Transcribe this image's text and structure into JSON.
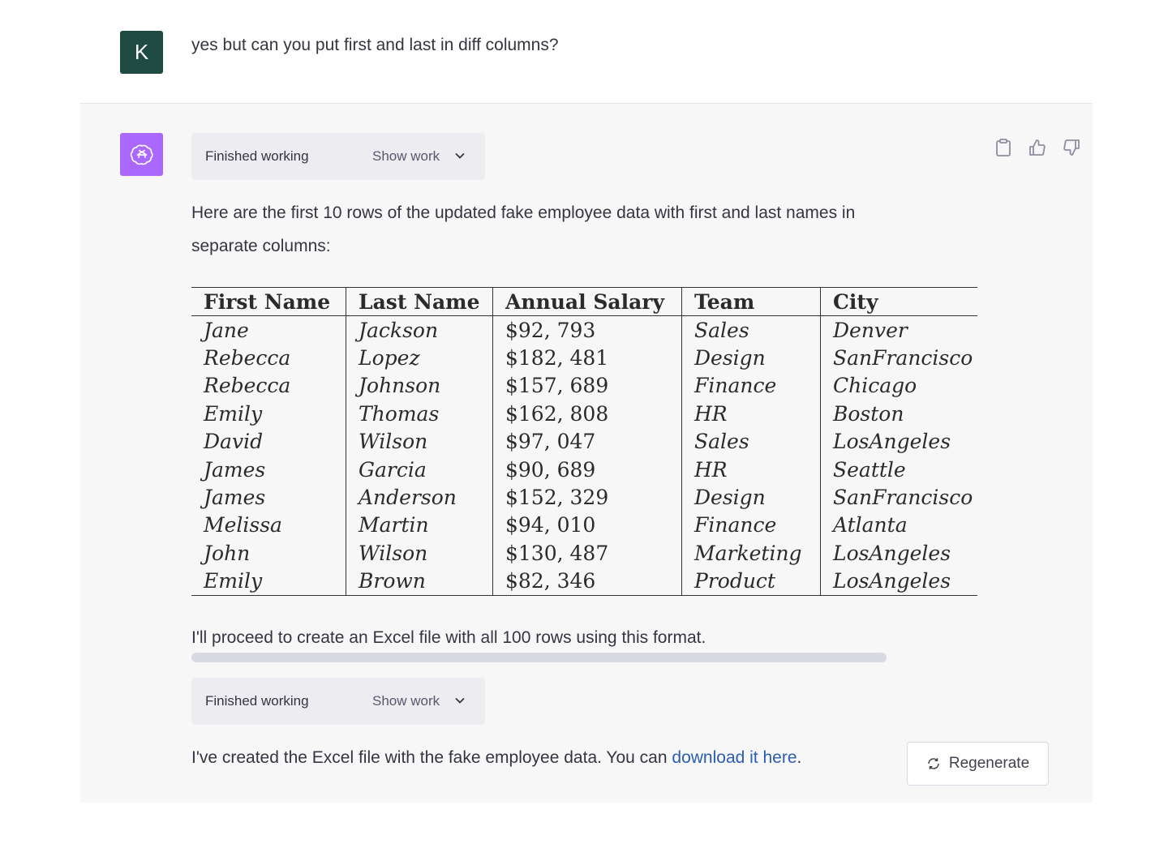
{
  "user": {
    "avatar_letter": "K",
    "message": "yes but can you put first and last in diff columns?"
  },
  "assistant": {
    "working1": {
      "status": "Finished working",
      "show": "Show work"
    },
    "intro_line1": "Here are the first 10 rows of the updated fake employee data with first and last names in",
    "intro_line2": "separate columns:",
    "table": {
      "headers": [
        "First Name",
        "Last Name",
        "Annual Salary",
        "Team",
        "City"
      ],
      "rows": [
        [
          "Jane",
          "Jackson",
          "$92, 793",
          "Sales",
          "Denver"
        ],
        [
          "Rebecca",
          "Lopez",
          "$182, 481",
          "Design",
          "SanFrancisco"
        ],
        [
          "Rebecca",
          "Johnson",
          "$157, 689",
          "Finance",
          "Chicago"
        ],
        [
          "Emily",
          "Thomas",
          "$162, 808",
          "HR",
          "Boston"
        ],
        [
          "David",
          "Wilson",
          "$97, 047",
          "Sales",
          "LosAngeles"
        ],
        [
          "James",
          "Garcia",
          "$90, 689",
          "HR",
          "Seattle"
        ],
        [
          "James",
          "Anderson",
          "$152, 329",
          "Design",
          "SanFrancisco"
        ],
        [
          "Melissa",
          "Martin",
          "$94, 010",
          "Finance",
          "Atlanta"
        ],
        [
          "John",
          "Wilson",
          "$130, 487",
          "Marketing",
          "LosAngeles"
        ],
        [
          "Emily",
          "Brown",
          "$82, 346",
          "Product",
          "LosAngeles"
        ]
      ]
    },
    "proceed_text": "I'll proceed to create an Excel file with all 100 rows using this format.",
    "working2": {
      "status": "Finished working",
      "show": "Show work"
    },
    "final_text": "I've created the Excel file with the fake employee data. You can ",
    "final_link": "download it here",
    "final_end": ".",
    "regenerate_label": "Regenerate"
  },
  "icons": [
    "copy-icon",
    "thumbs-up-icon",
    "thumbs-down-icon",
    "chevron-down-icon",
    "openai-logo-icon",
    "regenerate-icon"
  ]
}
